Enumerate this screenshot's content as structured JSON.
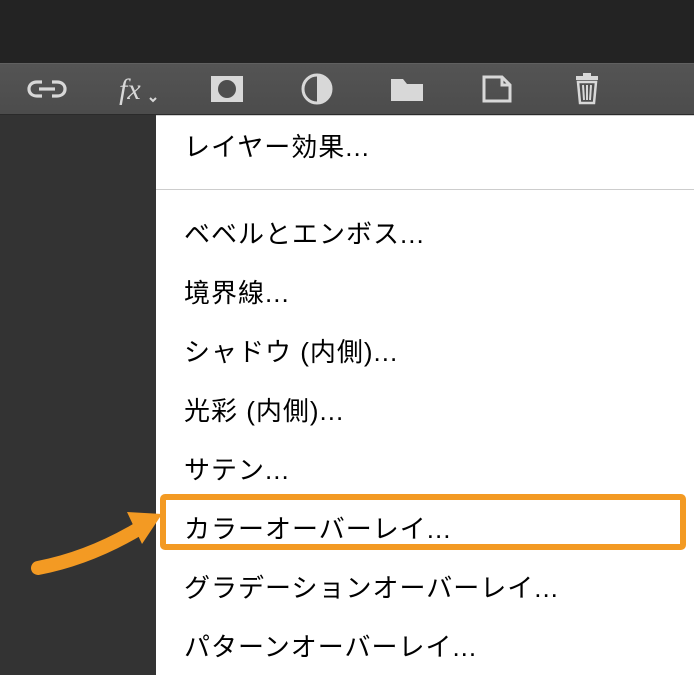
{
  "menu": {
    "header": "レイヤー効果...",
    "items": [
      "ベベルとエンボス...",
      "境界線...",
      "シャドウ (内側)...",
      "光彩 (内側)...",
      "サテン...",
      "カラーオーバーレイ...",
      "グラデーションオーバーレイ...",
      "パターンオーバーレイ..."
    ]
  },
  "icons": {
    "link": "link-icon",
    "fx": "fx-icon",
    "mask": "mask-icon",
    "adjustment": "adjustment-icon",
    "folder": "folder-icon",
    "newlayer": "new-layer-icon",
    "trash": "trash-icon"
  },
  "highlight_color": "#f39a23"
}
